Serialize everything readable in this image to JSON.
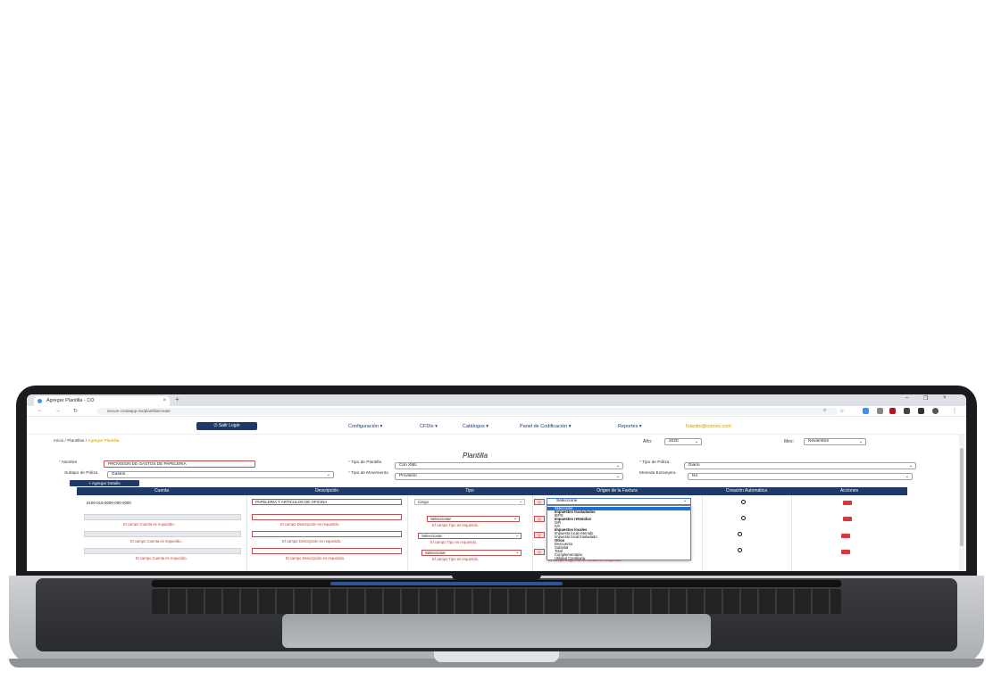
{
  "browser": {
    "tab_title": "Agregar Plantilla - CO",
    "new_tab": "+",
    "close_tab": "×",
    "url": "secure.contaapp.mx/plantilla/create",
    "win_min": "–",
    "win_max": "❐",
    "win_close": "×"
  },
  "header": {
    "logout_label": "⏻ Salir Login",
    "menu": [
      "Configuración ▾",
      "CFDIs ▾",
      "Catálogos ▾",
      "Panel de Codificación ▾",
      "Reportes ▾"
    ],
    "user": "fulanito@correo.com"
  },
  "breadcrumb": {
    "home": "Inicio",
    "sep1": " / ",
    "plantillas": "Plantillas",
    "sep2": " / ",
    "current": "Agregar Plantilla"
  },
  "period": {
    "year_label": "Año:",
    "year_value": "2020",
    "month_label": "Mes:",
    "month_value": "Noviembre"
  },
  "page_title": "Plantilla",
  "form": {
    "nombre_label": "Nombre",
    "nombre_value": "PROVISION DE GASTOS DE PAPELERIA",
    "subtipo_label": "Subtipo de Póliza",
    "subtipo_value": "Gastos",
    "tipo_plantilla_label": "Tipo de Plantilla",
    "tipo_plantilla_value": "Con XML",
    "tipo_movimiento_label": "Tipo de Movimiento",
    "tipo_movimiento_value": "Provisión",
    "tipo_poliza_label": "Tipo de Póliza",
    "tipo_poliza_value": "Diario",
    "moneda_label": "Moneda Extranjera",
    "moneda_value": "No",
    "required_mark": "*"
  },
  "add_detail_label": "+ Agregar Detalle",
  "table": {
    "columns": [
      "Cuenta",
      "Descripción",
      "Tipo",
      "Origen de la Factura",
      "Creación Automática",
      "Acciones"
    ],
    "rows": [
      {
        "cuenta": "6100-016-0000-000-0000",
        "descripcion": "PAPELERIA Y ARTICULOS DE OFICINA",
        "tipo": "Cargo",
        "origen": "Seleccione"
      },
      {
        "cuenta": "",
        "descripcion": "",
        "tipo": "Seleccionar",
        "origen": ""
      },
      {
        "cuenta": "",
        "descripcion": "",
        "tipo": "Seleccionar",
        "origen": ""
      },
      {
        "cuenta": "",
        "descripcion": "",
        "tipo": "Seleccionar",
        "origen": ""
      }
    ],
    "err_cuenta": "El campo Cuenta es requerido.",
    "err_descripcion": "El campo Descripción es requerido.",
    "err_tipo": "El campo Tipo es requerido.",
    "err_origen": "El campo Origen de la Factura es requerido.",
    "search_icon": "Q"
  },
  "dropdown": {
    "selected": "Seleccione",
    "items": [
      "Seleccione",
      "Impuestos trasladados",
      "IEPS",
      "Impuestos retenidos",
      "ISR",
      "IVA",
      "Impuestos locales",
      "Impuesto local retenido",
      "Impuesto local trasladado",
      "Otros",
      "Descuento",
      "Subtotal",
      "Total",
      "Complementaria",
      "Utilidad Cambiaria",
      "Pérdida Cambiaria"
    ]
  },
  "colors": {
    "navy": "#1f3a68",
    "gold": "#c79a00",
    "error": "#c0392b",
    "delete": "#d9363e"
  }
}
